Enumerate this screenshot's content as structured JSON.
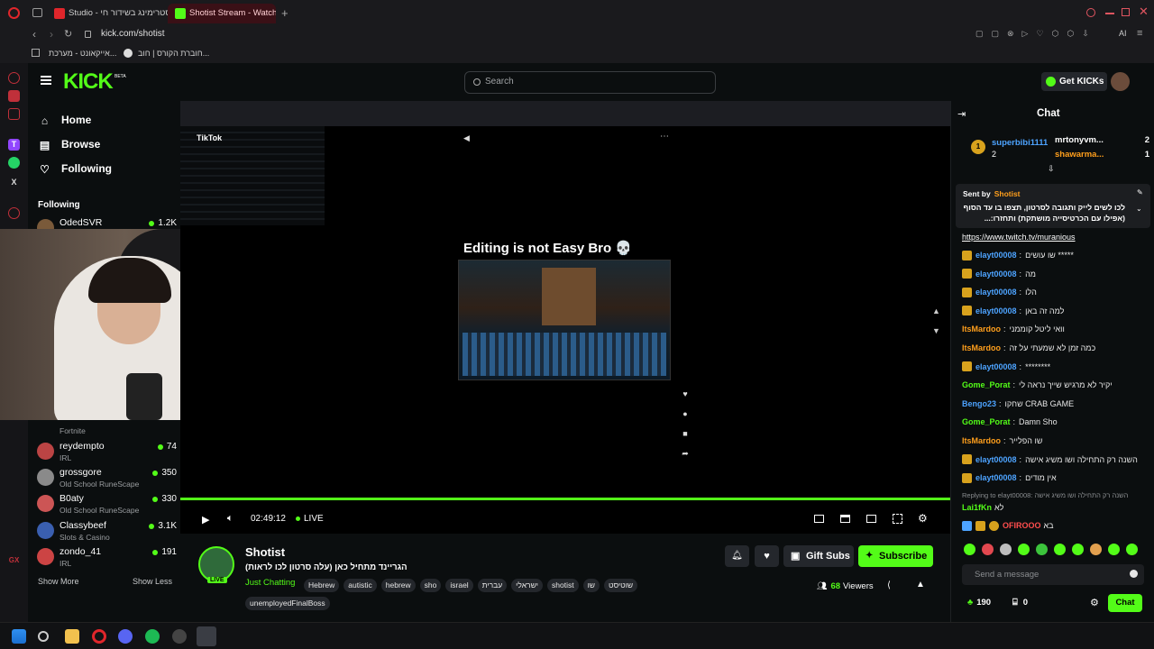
{
  "browser": {
    "tabs": [
      {
        "label": "Studio - סטרימינג בשידור חי",
        "active": false
      },
      {
        "label": "Shotist Stream - Watch Liv",
        "active": true
      }
    ],
    "url": "kick.com/shotist",
    "bookmarks": [
      "אייקאונט - מערכת...",
      "חוברת הקורס | חוב..."
    ],
    "ai_label": "AI"
  },
  "header": {
    "logo": "KICK",
    "logo_beta": "BETA",
    "search_placeholder": "Search",
    "get_kicks": "Get KICKs"
  },
  "leftnav": {
    "items": [
      {
        "label": "Home",
        "icon": "home-icon"
      },
      {
        "label": "Browse",
        "icon": "browse-icon"
      },
      {
        "label": "Following",
        "icon": "heart-icon"
      }
    ],
    "following_title": "Following",
    "channels": [
      {
        "name": "OdedSVR",
        "category": "",
        "viewers": "1.2K",
        "color": "#7a5a3a"
      },
      {
        "name": "",
        "category": "Fortnite",
        "viewers": "",
        "color": "#555"
      },
      {
        "name": "reydempto",
        "category": "IRL",
        "viewers": "74",
        "color": "#b44"
      },
      {
        "name": "grossgore",
        "category": "Old School RuneScape",
        "viewers": "350",
        "color": "#8a8a8a"
      },
      {
        "name": "B0aty",
        "category": "Old School RuneScape",
        "viewers": "330",
        "color": "#c55"
      },
      {
        "name": "Classybeef",
        "category": "Slots & Casino",
        "viewers": "3.1K",
        "color": "#3a5fb0"
      },
      {
        "name": "zondo_41",
        "category": "IRL",
        "viewers": "191",
        "color": "#c44"
      }
    ],
    "show_more": "Show More",
    "show_less": "Show Less"
  },
  "player": {
    "video_title": "Editing is not Easy Bro 💀",
    "tiktok_label": "TikTok",
    "time": "02:49:12",
    "live": "LIVE",
    "progress": 1.0
  },
  "info": {
    "streamer": "Shotist",
    "stream_title": "הגריינד מתחיל כאן (עלה סרטון לכו לראות)",
    "category": "Just Chatting",
    "tags": [
      "Hebrew",
      "autistic",
      "hebrew",
      "sho",
      "israel",
      "עברית",
      "ישראלי",
      "shotist",
      "שו",
      "שוטיסט",
      "unemployedFinalBoss"
    ],
    "live_badge": "LIVE",
    "gift_subs": "Gift Subs",
    "subscribe": "Subscribe",
    "viewers_count": "68",
    "viewers_label": "Viewers"
  },
  "chat": {
    "title": "Chat",
    "gifters": [
      {
        "rank": "1",
        "name": "superbibi1111",
        "count": "2"
      },
      {
        "rank": "",
        "name": "mrtonyvm...",
        "count": "2"
      },
      {
        "rank": "",
        "name": "shawarma...",
        "count": "1"
      }
    ],
    "pinned": {
      "sent_by": "Sent by",
      "sender": "Shotist",
      "text": "לכו לשים לייק ותגובה לסרטון, תצפו בו עד הסוף (אפילו עם הכרטיסייה מושתקת) ותחזרו:..."
    },
    "link": "https://www.twitch.tv/muranious",
    "messages": [
      {
        "user": "elayt00008",
        "text": "שו עושים *****",
        "badge": true,
        "color": "#4da3ff"
      },
      {
        "user": "elayt00008",
        "text": "מה",
        "badge": true,
        "color": "#4da3ff"
      },
      {
        "user": "elayt00008",
        "text": "הלו",
        "badge": true,
        "color": "#4da3ff"
      },
      {
        "user": "elayt00008",
        "text": "למה זה באן",
        "badge": true,
        "color": "#4da3ff"
      },
      {
        "user": "ItsMardoo",
        "text": "וואי ליטל קוממני",
        "badge": false,
        "color": "#ff9f1c"
      },
      {
        "user": "ItsMardoo",
        "text": "כמה זמן לא שמעתי על זה",
        "badge": false,
        "color": "#ff9f1c"
      },
      {
        "user": "elayt00008",
        "text": "********",
        "badge": true,
        "color": "#4da3ff"
      },
      {
        "user": "Gome_Porat",
        "text": "יקיר לא מרגיש שייך נראה לי",
        "badge": false,
        "color": "#53fc18"
      },
      {
        "user": "Bengo23",
        "text": "שחקו CRAB GAME",
        "badge": false,
        "color": "#4da3ff"
      },
      {
        "user": "Gome_Porat",
        "text": "Damn Sho",
        "badge": false,
        "color": "#53fc18"
      },
      {
        "user": "ItsMardoo",
        "text": "שו הפלייר",
        "badge": false,
        "color": "#ff9f1c"
      },
      {
        "user": "elayt00008",
        "text": "השנה רק התחילה ושו משיג אישה",
        "badge": true,
        "color": "#4da3ff"
      },
      {
        "user": "elayt00008",
        "text": "אין מודים",
        "badge": true,
        "color": "#4da3ff"
      }
    ],
    "reply_to": "Replying to elayt00008: השנה רק התחילה ושו משיג אישה",
    "reply_msg": {
      "user": "Lai1fKn",
      "text": "לא"
    },
    "last_msg": {
      "user": "OFIROOO",
      "text": "בא"
    },
    "input_placeholder": "Send a message",
    "kicks_count": "190",
    "sub_count": "0",
    "send_label": "Chat"
  }
}
